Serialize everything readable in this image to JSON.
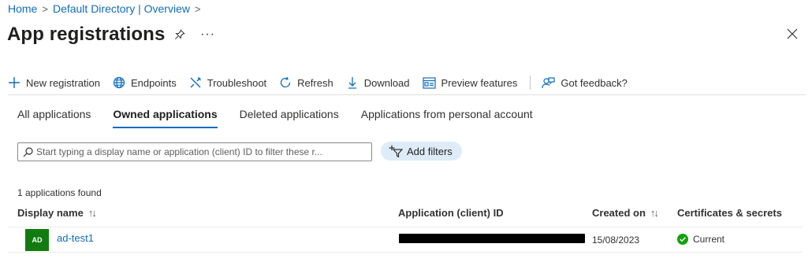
{
  "breadcrumb": {
    "items": [
      "Home",
      "Default Directory | Overview"
    ],
    "separator": ">"
  },
  "header": {
    "title": "App registrations",
    "more_label": "···"
  },
  "toolbar": {
    "new_registration": "New registration",
    "endpoints": "Endpoints",
    "troubleshoot": "Troubleshoot",
    "refresh": "Refresh",
    "download": "Download",
    "preview_features": "Preview features",
    "feedback": "Got feedback?"
  },
  "tabs": [
    {
      "label": "All applications",
      "active": false
    },
    {
      "label": "Owned applications",
      "active": true
    },
    {
      "label": "Deleted applications",
      "active": false
    },
    {
      "label": "Applications from personal account",
      "active": false
    }
  ],
  "search": {
    "placeholder": "Start typing a display name or application (client) ID to filter these r...",
    "value": ""
  },
  "filters": {
    "add_label": "Add filters"
  },
  "table": {
    "count_text": "1 applications found",
    "columns": {
      "display_name": "Display name",
      "client_id": "Application (client) ID",
      "created_on": "Created on",
      "certificates": "Certificates & secrets"
    },
    "sort_glyph": "↑↓",
    "rows": [
      {
        "initials": "AD",
        "name": "ad-test1",
        "client_id": "",
        "created_on": "15/08/2023",
        "certificates_status": "Current"
      }
    ]
  },
  "colors": {
    "accent": "#0f6cbd",
    "avatar_bg": "#107c10",
    "status_ok": "#13a10e",
    "filter_pill": "#deecf9"
  }
}
